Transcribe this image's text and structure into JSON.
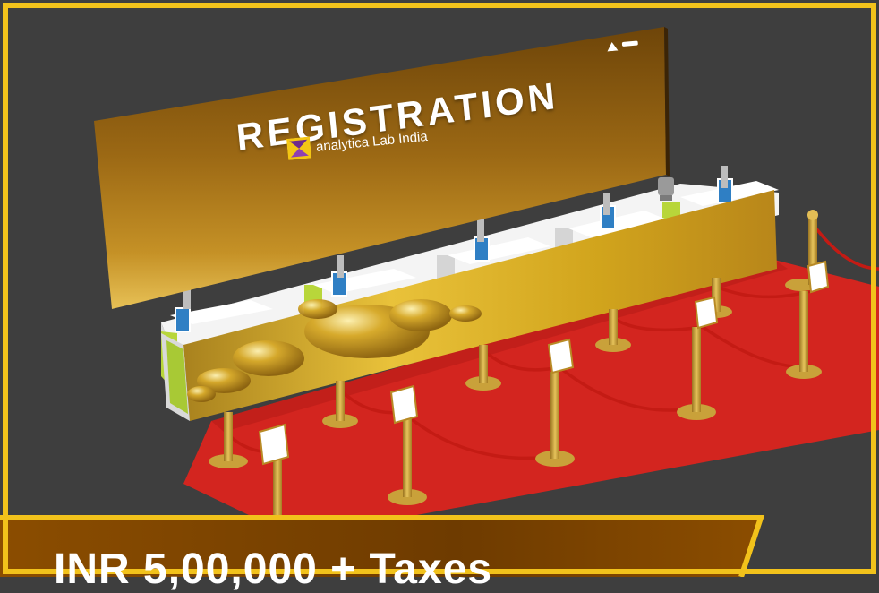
{
  "banner": {
    "title": "REGISTRATION",
    "brand": "analytica Lab India"
  },
  "price": {
    "label": "INR 5,00,000 + Taxes"
  },
  "icons": {
    "brand_logo": "analytica-logo-icon",
    "sponsor_logo_1": "organizer-logo-icon",
    "sponsor_logo_2": "partner-logo-icon",
    "sign": "queue-sign-icon",
    "tablet": "tablet-stand-icon"
  },
  "colors": {
    "floor": "#3e3e3e",
    "carpet": "#d3251f",
    "gold": "#c99a2e",
    "frame": "#f2c21b",
    "banner_brown": "#7a4300"
  }
}
